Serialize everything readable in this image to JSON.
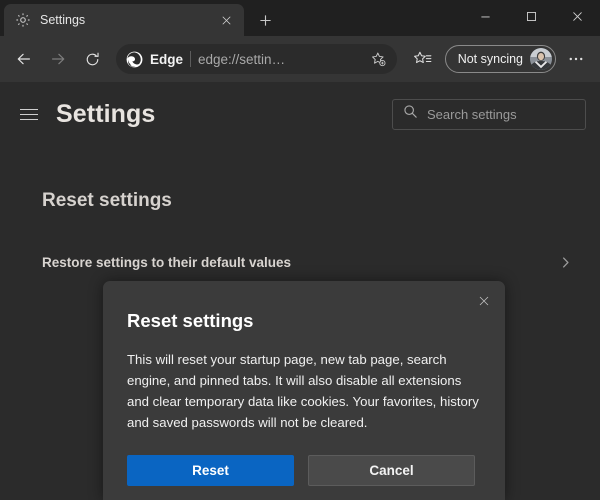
{
  "window": {
    "controls": [
      {
        "name": "minimize",
        "glyph": "─"
      },
      {
        "name": "maximize",
        "glyph": "□"
      },
      {
        "name": "close",
        "glyph": "✕"
      }
    ]
  },
  "tabstrip": {
    "tab": {
      "favicon": "gear-icon",
      "title": "Settings",
      "close_glyph": "✕"
    },
    "newtab_glyph": "+",
    "newtab_label": "New tab"
  },
  "toolbar": {
    "back_label": "Back",
    "forward_label": "Forward",
    "refresh_label": "Refresh",
    "omnibox": {
      "brand": "Edge",
      "url": "edge://settin…",
      "favorite_icon": "add-favorite-star-icon"
    },
    "favorites_label": "Favorites",
    "profile": {
      "label": "Not syncing",
      "avatar": "user-avatar"
    },
    "more_glyph": "…",
    "more_label": "Settings and more"
  },
  "settings_header": {
    "menu_label": "Settings menu",
    "title": "Settings",
    "search": {
      "placeholder": "Search settings",
      "icon": "search-icon",
      "value": ""
    }
  },
  "page": {
    "section_title": "Reset settings",
    "rows": [
      {
        "label": "Restore settings to their default values",
        "chevron": "›"
      }
    ]
  },
  "dialog": {
    "title": "Reset settings",
    "close_glyph": "✕",
    "body": "This will reset your startup page, new tab page, search engine, and pinned tabs. It will also disable all extensions and clear temporary data like cookies. Your favorites, history and saved passwords will not be cleared.",
    "primary_button": "Reset",
    "secondary_button": "Cancel"
  },
  "colors": {
    "titlebar": "#202020",
    "toolbar": "#353535",
    "page_bg": "#2b2b2b",
    "dialog_bg": "#3b3b3b",
    "accent": "#0a65c2",
    "text_primary": "#f0f0f0",
    "text_muted": "#9a9a9a"
  }
}
